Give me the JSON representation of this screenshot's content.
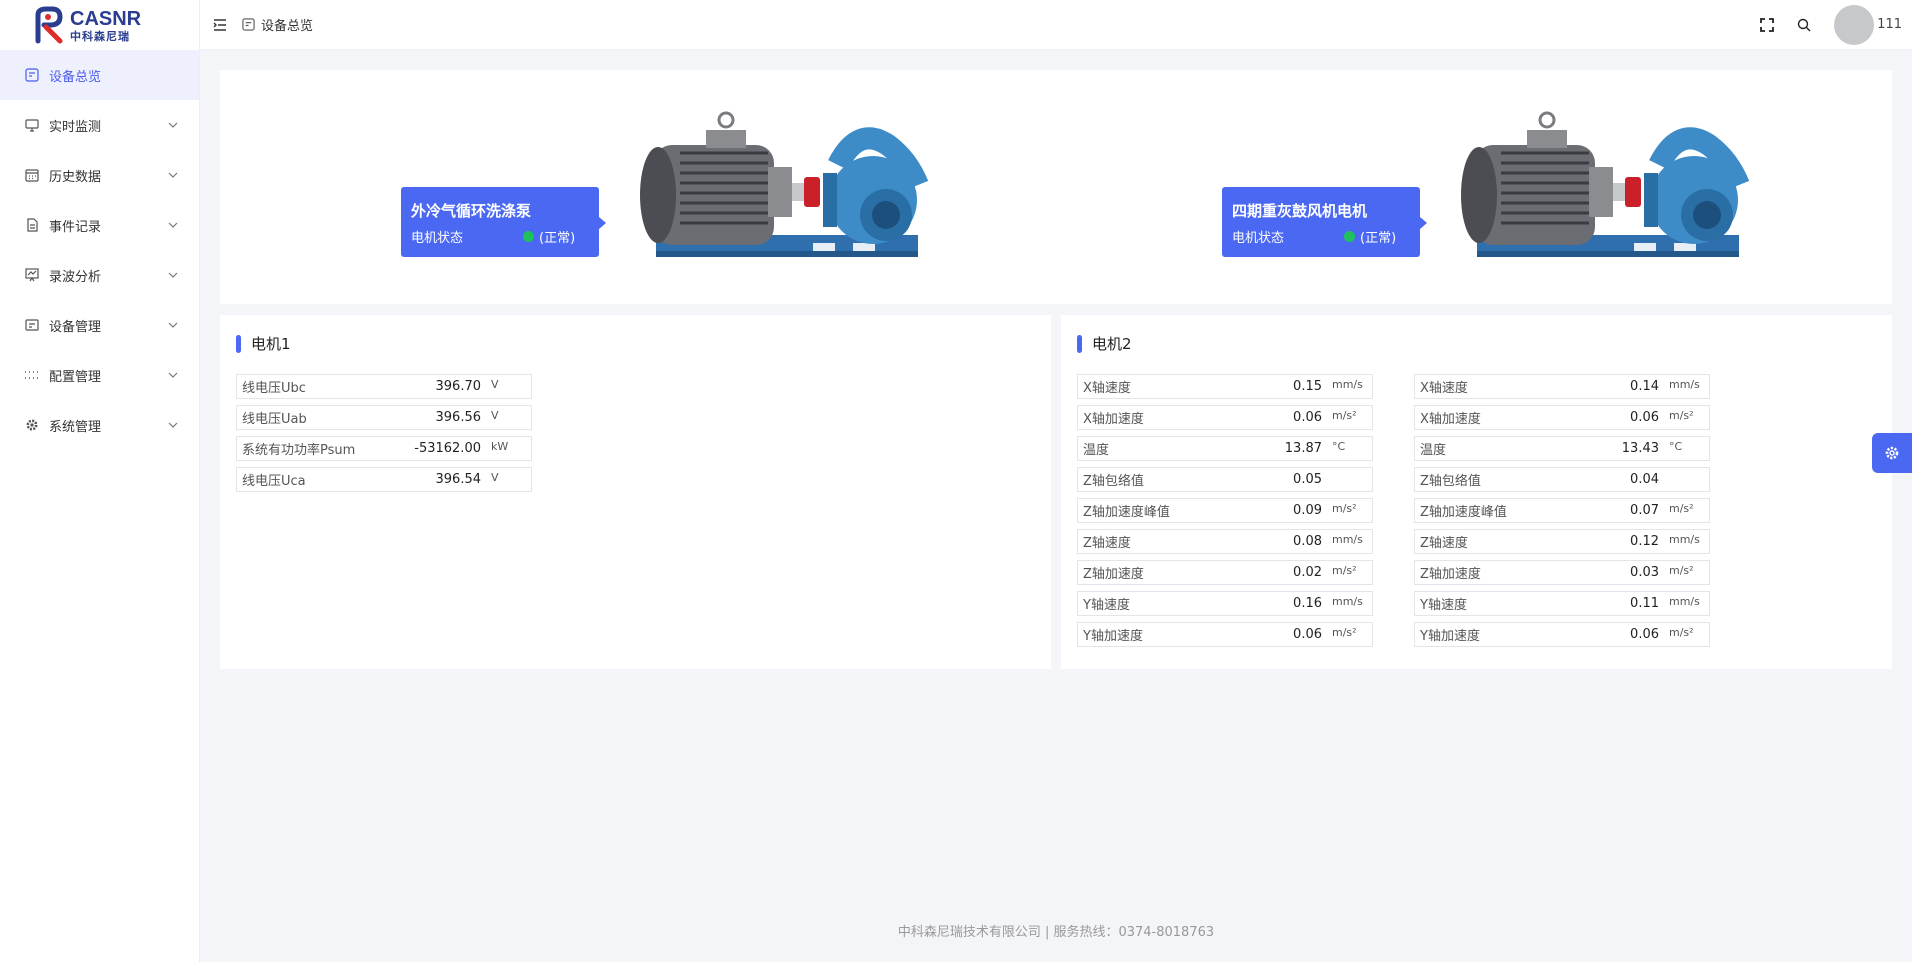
{
  "brand": {
    "en": "CASNR",
    "cn": "中科森尼瑞"
  },
  "sidebar": {
    "items": [
      {
        "label": "设备总览",
        "icon": "dashboard-icon",
        "active": true
      },
      {
        "label": "实时监测",
        "icon": "monitor-icon"
      },
      {
        "label": "历史数据",
        "icon": "calendar-icon"
      },
      {
        "label": "事件记录",
        "icon": "document-icon"
      },
      {
        "label": "录波分析",
        "icon": "chart-board-icon"
      },
      {
        "label": "设备管理",
        "icon": "device-icon"
      },
      {
        "label": "配置管理",
        "icon": "config-icon"
      },
      {
        "label": "系统管理",
        "icon": "gear-icon"
      }
    ]
  },
  "header": {
    "breadcrumb": "设备总览",
    "username": "111"
  },
  "motors": [
    {
      "name": "外冷气循环洗涤泵",
      "status_label": "电机状态",
      "status": "(正常)",
      "status_color": "#1fc25a"
    },
    {
      "name": "四期重灰鼓风机电机",
      "status_label": "电机状态",
      "status": "(正常)",
      "status_color": "#1fc25a"
    }
  ],
  "panel1": {
    "title": "电机1",
    "rows": [
      {
        "label": "线电压Ubc",
        "value": "396.70",
        "unit": "V"
      },
      {
        "label": "线电压Uab",
        "value": "396.56",
        "unit": "V"
      },
      {
        "label": "系统有功功率Psum",
        "value": "-53162.00",
        "unit": "kW"
      },
      {
        "label": "线电压Uca",
        "value": "396.54",
        "unit": "V"
      }
    ]
  },
  "panel2": {
    "title": "电机2",
    "left": [
      {
        "label": "X轴速度",
        "value": "0.15",
        "unit": "mm/s"
      },
      {
        "label": "X轴加速度",
        "value": "0.06",
        "unit": "m/s²"
      },
      {
        "label": "温度",
        "value": "13.87",
        "unit": "°C"
      },
      {
        "label": "Z轴包络值",
        "value": "0.05",
        "unit": ""
      },
      {
        "label": "Z轴加速度峰值",
        "value": "0.09",
        "unit": "m/s²"
      },
      {
        "label": "Z轴速度",
        "value": "0.08",
        "unit": "mm/s"
      },
      {
        "label": "Z轴加速度",
        "value": "0.02",
        "unit": "m/s²"
      },
      {
        "label": "Y轴速度",
        "value": "0.16",
        "unit": "mm/s"
      },
      {
        "label": "Y轴加速度",
        "value": "0.06",
        "unit": "m/s²"
      }
    ],
    "right": [
      {
        "label": "X轴速度",
        "value": "0.14",
        "unit": "mm/s"
      },
      {
        "label": "X轴加速度",
        "value": "0.06",
        "unit": "m/s²"
      },
      {
        "label": "温度",
        "value": "13.43",
        "unit": "°C"
      },
      {
        "label": "Z轴包络值",
        "value": "0.04",
        "unit": ""
      },
      {
        "label": "Z轴加速度峰值",
        "value": "0.07",
        "unit": "m/s²"
      },
      {
        "label": "Z轴速度",
        "value": "0.12",
        "unit": "mm/s"
      },
      {
        "label": "Z轴加速度",
        "value": "0.03",
        "unit": "m/s²"
      },
      {
        "label": "Y轴速度",
        "value": "0.11",
        "unit": "mm/s"
      },
      {
        "label": "Y轴加速度",
        "value": "0.06",
        "unit": "m/s²"
      }
    ]
  },
  "footer": "中科森尼瑞技术有限公司 | 服务热线：0374-8018763",
  "colors": {
    "accent": "#4a68f2",
    "active_bg": "#eef0fe",
    "normal": "#1fc25a"
  }
}
